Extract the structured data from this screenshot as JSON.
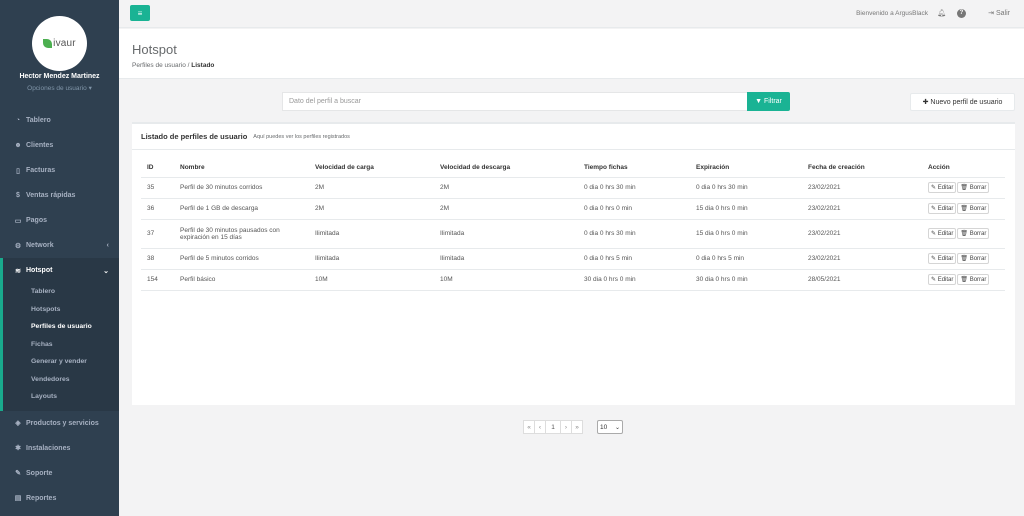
{
  "brand": {
    "logo_text": "ivaur"
  },
  "user": {
    "name": "Hector Mendez Martinez",
    "options": "Opciones de usuario ▾"
  },
  "sidebar": {
    "items": [
      {
        "label": "Tablero",
        "icon": "tachometer-icon"
      },
      {
        "label": "Clientes",
        "icon": "users-icon"
      },
      {
        "label": "Facturas",
        "icon": "file-icon"
      },
      {
        "label": "Ventas rápidas",
        "icon": "dollar-icon"
      },
      {
        "label": "Pagos",
        "icon": "money-icon"
      },
      {
        "label": "Network",
        "icon": "sitemap-icon"
      }
    ],
    "active_group": {
      "label": "Hotspot",
      "icon": "wifi-icon",
      "subitems": [
        "Tablero",
        "Hotspots",
        "Perfiles de usuario",
        "Fichas",
        "Generar y vender",
        "Vendedores",
        "Layouts"
      ]
    },
    "items_after": [
      {
        "label": "Productos y servicios",
        "icon": "tags-icon"
      },
      {
        "label": "Instalaciones",
        "icon": "gears-icon"
      },
      {
        "label": "Soporte",
        "icon": "wrench-icon"
      },
      {
        "label": "Reportes",
        "icon": "book-icon"
      }
    ]
  },
  "topbar": {
    "welcome": "Bienvenido a ArgusBlack",
    "logout": "Salir"
  },
  "page": {
    "title": "Hotspot",
    "breadcrumb_1": "Perfiles de usuario",
    "breadcrumb_2": "Listado"
  },
  "search": {
    "placeholder": "Dato del perfil a buscar",
    "filter_label": "Filtrar"
  },
  "new_profile_label": "Nuevo perfil de usuario",
  "panel": {
    "title": "Listado de perfiles de usuario",
    "subtitle": "Aquí puedes ver los perfiles registrados"
  },
  "table": {
    "headers": [
      "ID",
      "Nombre",
      "Velocidad de carga",
      "Velocidad de descarga",
      "Tiempo fichas",
      "Expiración",
      "Fecha de creación",
      "Acción"
    ],
    "rows": [
      [
        "35",
        "Perfil de 30 minutos corridos",
        "2M",
        "2M",
        "0 dia 0 hrs 30 min",
        "0 dia 0 hrs 30 min",
        "23/02/2021"
      ],
      [
        "36",
        "Perfil de 1 GB de descarga",
        "2M",
        "2M",
        "0 dia 0 hrs 0 min",
        "15 dia 0 hrs 0 min",
        "23/02/2021"
      ],
      [
        "37",
        "Perfil de 30 minutos pausados con expiración en 15 días",
        "Ilimitada",
        "Ilimitada",
        "0 dia 0 hrs 30 min",
        "15 dia 0 hrs 0 min",
        "23/02/2021"
      ],
      [
        "38",
        "Perfil de 5 minutos corridos",
        "Ilimitada",
        "Ilimitada",
        "0 dia 0 hrs 5 min",
        "0 dia 0 hrs 5 min",
        "23/02/2021"
      ],
      [
        "154",
        "Perfil básico",
        "10M",
        "10M",
        "30 dia 0 hrs 0 min",
        "30 dia 0 hrs 0 min",
        "28/05/2021"
      ]
    ],
    "edit_label": "Editar",
    "delete_label": "Borrar"
  },
  "pagination": {
    "first": "«",
    "prev": "‹",
    "current": "1",
    "next": "›",
    "last": "»",
    "page_size": "10"
  },
  "colors": {
    "accent": "#1ab394",
    "sidebar": "#2f4050"
  }
}
